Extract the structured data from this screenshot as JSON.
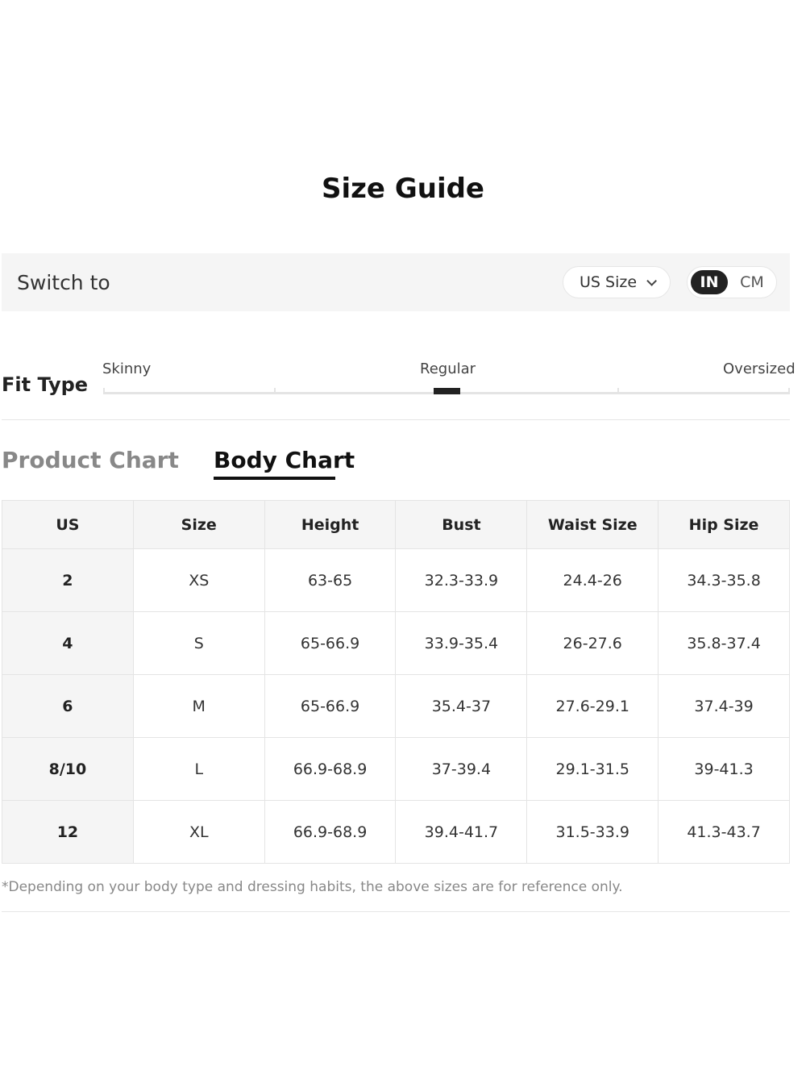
{
  "title": "Size Guide",
  "switch": {
    "label": "Switch to",
    "size_system": "US Size",
    "units": {
      "active": "IN",
      "inactive": "CM"
    }
  },
  "fit": {
    "label": "Fit Type",
    "options": [
      "Skinny",
      "Regular",
      "Oversized"
    ],
    "selected": "Regular"
  },
  "tabs": {
    "product": "Product Chart",
    "body": "Body Chart",
    "active": "Body Chart"
  },
  "table": {
    "headers": [
      "US",
      "Size",
      "Height",
      "Bust",
      "Waist Size",
      "Hip Size"
    ],
    "rows": [
      [
        "2",
        "XS",
        "63-65",
        "32.3-33.9",
        "24.4-26",
        "34.3-35.8"
      ],
      [
        "4",
        "S",
        "65-66.9",
        "33.9-35.4",
        "26-27.6",
        "35.8-37.4"
      ],
      [
        "6",
        "M",
        "65-66.9",
        "35.4-37",
        "27.6-29.1",
        "37.4-39"
      ],
      [
        "8/10",
        "L",
        "66.9-68.9",
        "37-39.4",
        "29.1-31.5",
        "39-41.3"
      ],
      [
        "12",
        "XL",
        "66.9-68.9",
        "39.4-41.7",
        "31.5-33.9",
        "41.3-43.7"
      ]
    ]
  },
  "note": "*Depending on your body type and dressing habits, the above sizes are for reference only."
}
